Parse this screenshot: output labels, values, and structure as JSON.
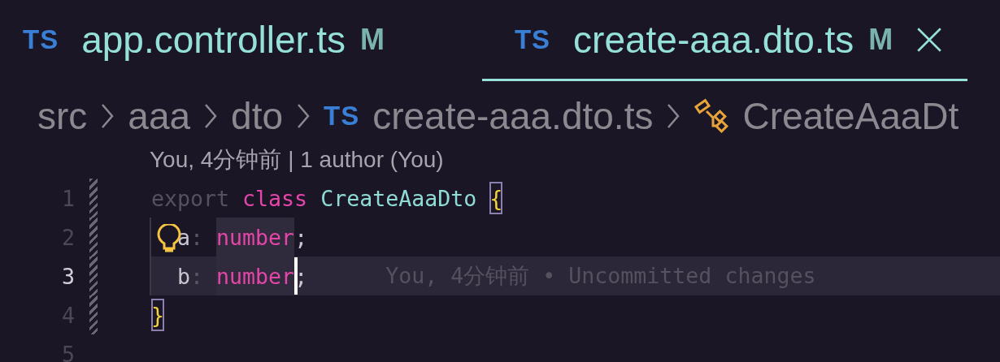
{
  "tabs": [
    {
      "badge": "TS",
      "label": "app.controller.ts",
      "status": "M",
      "selected": false
    },
    {
      "badge": "TS",
      "label": "create-aaa.dto.ts",
      "status": "M",
      "selected": true
    }
  ],
  "breadcrumb": [
    {
      "kind": "folder",
      "label": "src"
    },
    {
      "kind": "folder",
      "label": "aaa"
    },
    {
      "kind": "folder",
      "label": "dto"
    },
    {
      "kind": "file",
      "badge": "TS",
      "label": "create-aaa.dto.ts"
    },
    {
      "kind": "symbol",
      "label": "CreateAaaDt"
    }
  ],
  "codelens": "You, 4分钟前 | 1 author (You)",
  "lines": [
    {
      "number": "1",
      "current": false,
      "changed": true,
      "lightbulb": false,
      "indent_guide": false,
      "tokens": [
        {
          "kind": "muted",
          "text": "export "
        },
        {
          "kind": "keyword",
          "text": "class "
        },
        {
          "kind": "type",
          "text": "CreateAaaDto "
        },
        {
          "kind": "brace-match",
          "text": "{"
        }
      ]
    },
    {
      "number": "2",
      "current": false,
      "changed": true,
      "lightbulb": true,
      "indent_guide": true,
      "indented": true,
      "tokens": [
        {
          "kind": "plain",
          "text": "a"
        },
        {
          "kind": "punct",
          "text": ": "
        },
        {
          "kind": "keyword",
          "text": "number",
          "highlight": true
        },
        {
          "kind": "plain",
          "text": ";"
        }
      ]
    },
    {
      "number": "3",
      "current": true,
      "changed": true,
      "lightbulb": false,
      "indent_guide": true,
      "indented": true,
      "blame": "You, 4分钟前 • Uncommitted changes",
      "tokens": [
        {
          "kind": "plain",
          "text": "b"
        },
        {
          "kind": "punct",
          "text": ": "
        },
        {
          "kind": "keyword",
          "text": "number",
          "highlight": true,
          "cursor": true
        },
        {
          "kind": "plain",
          "text": ";"
        }
      ]
    },
    {
      "number": "4",
      "current": false,
      "changed": true,
      "lightbulb": false,
      "indent_guide": false,
      "tokens": [
        {
          "kind": "brace-match",
          "text": "}"
        }
      ]
    },
    {
      "number": "5",
      "current": false,
      "changed": false,
      "lightbulb": false,
      "indent_guide": false
    }
  ]
}
